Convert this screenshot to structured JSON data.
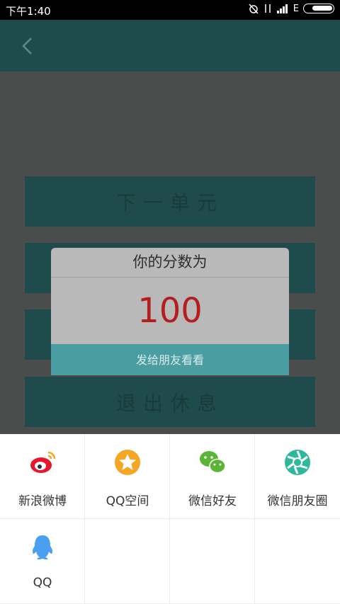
{
  "status": {
    "time": "下午1:40",
    "network": "E"
  },
  "menu": [
    "下一单元",
    "",
    "",
    "退出休息"
  ],
  "dialog": {
    "title": "你的分数为",
    "score": "100",
    "action": "发给朋友看看"
  },
  "share": [
    {
      "label": "新浪微博",
      "icon": "weibo-icon",
      "color": "#e6162d"
    },
    {
      "label": "QQ空间",
      "icon": "qzone-icon",
      "color": "#f5a623"
    },
    {
      "label": "微信好友",
      "icon": "wechat-icon",
      "color": "#5ab536"
    },
    {
      "label": "微信朋友圈",
      "icon": "moments-icon",
      "color": "#2fb99c"
    },
    {
      "label": "QQ",
      "icon": "qq-icon",
      "color": "#4a9ff0"
    }
  ]
}
